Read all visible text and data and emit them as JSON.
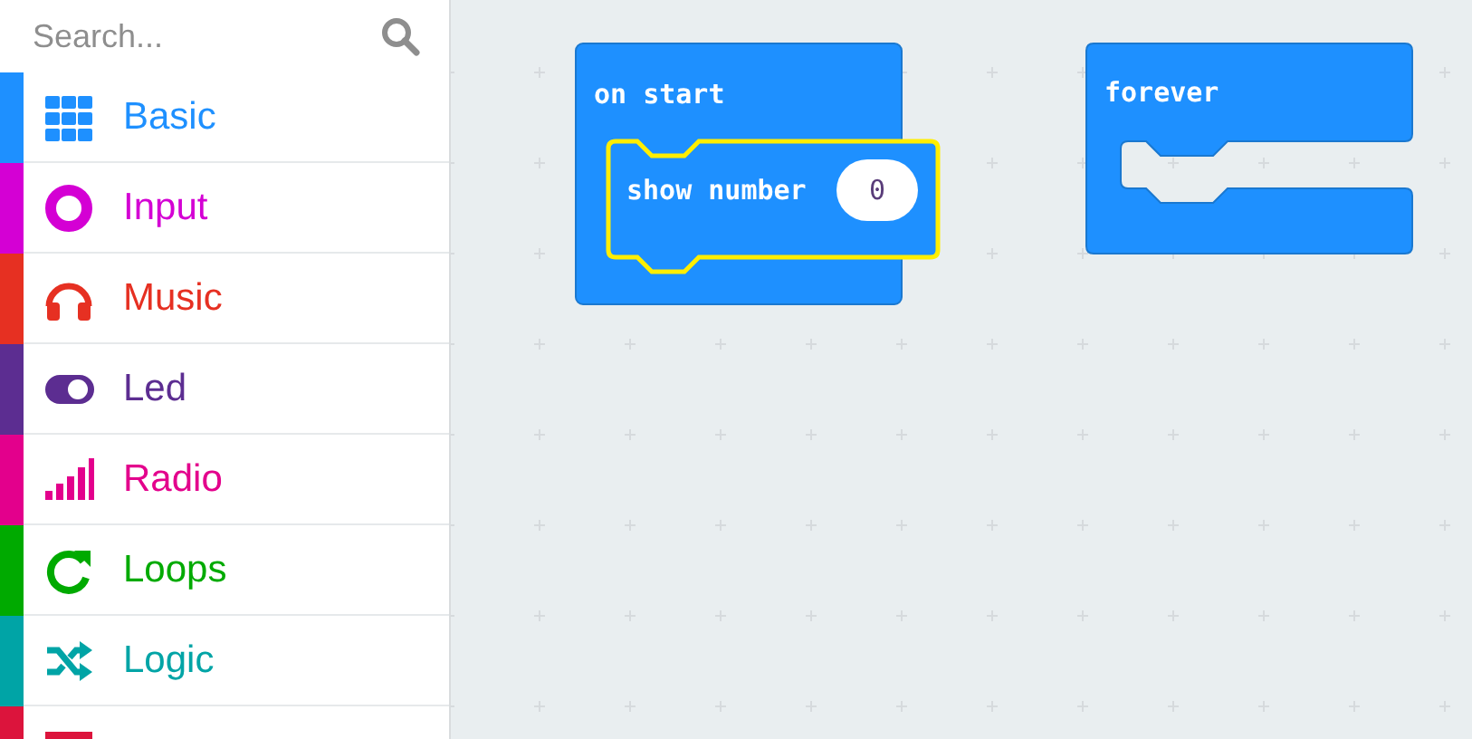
{
  "search": {
    "placeholder": "Search..."
  },
  "categories": [
    {
      "label": "Basic",
      "color": "#1e90ff"
    },
    {
      "label": "Input",
      "color": "#d400d4"
    },
    {
      "label": "Music",
      "color": "#e63022"
    },
    {
      "label": "Led",
      "color": "#5c2d91"
    },
    {
      "label": "Radio",
      "color": "#e3008c"
    },
    {
      "label": "Loops",
      "color": "#00aa00"
    },
    {
      "label": "Logic",
      "color": "#00a4a6"
    },
    {
      "color": "#dc143c"
    }
  ],
  "workspace": {
    "blocks": [
      {
        "kind": "event",
        "label": "on start",
        "children": [
          {
            "kind": "statement",
            "label": "show number",
            "value": "0"
          }
        ]
      },
      {
        "kind": "loop",
        "label": "forever"
      }
    ]
  }
}
